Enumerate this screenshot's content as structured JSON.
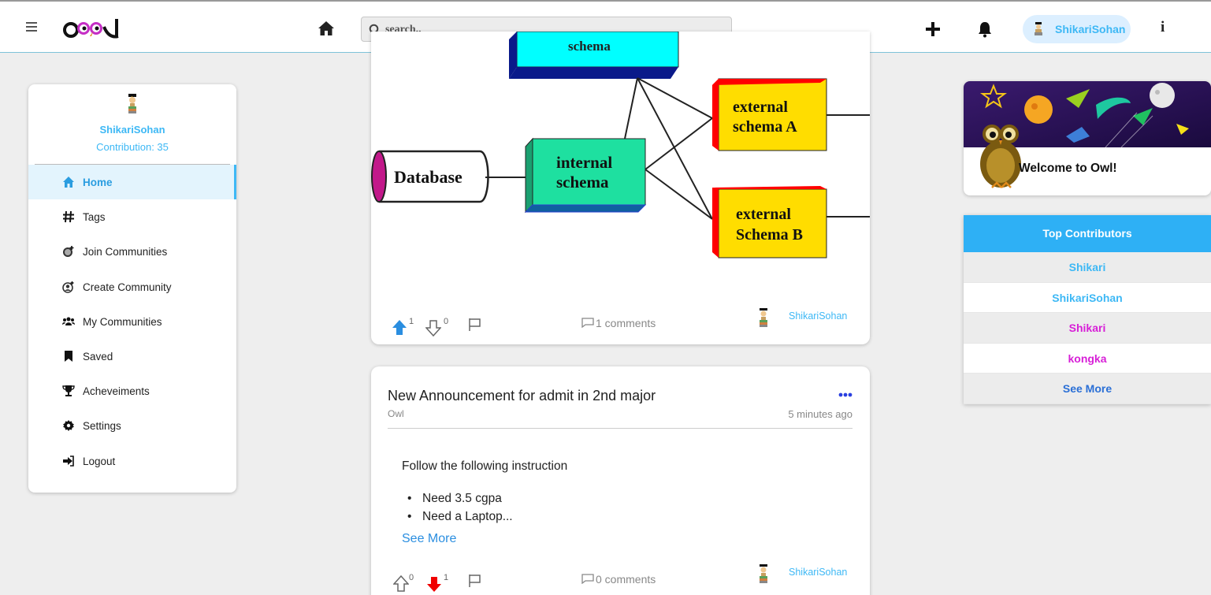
{
  "navbar": {
    "logo_text": "Owl",
    "search_placeholder": "search..",
    "username": "ShikariSohan",
    "info_glyph": "i",
    "icons": [
      "menu-icon",
      "home-icon",
      "search-icon",
      "plus-icon",
      "bell-icon",
      "info-icon"
    ]
  },
  "sidebar": {
    "username": "ShikariSohan",
    "contribution": "Contribution: 35",
    "items": [
      {
        "label": "Home",
        "icon": "home-icon",
        "active": true
      },
      {
        "label": "Tags",
        "icon": "hash-icon"
      },
      {
        "label": "Join Communities",
        "icon": "globe-plus-icon"
      },
      {
        "label": "Create Community",
        "icon": "user-plus-icon"
      },
      {
        "label": "My Communities",
        "icon": "users-icon"
      },
      {
        "label": "Saved",
        "icon": "bookmark-icon"
      },
      {
        "label": "Acheveiments",
        "icon": "trophy-icon"
      },
      {
        "label": "Settings",
        "icon": "cog-icon"
      },
      {
        "label": "Logout",
        "icon": "logout-icon"
      }
    ]
  },
  "post1": {
    "diagram": {
      "database": "Database",
      "internal_1": "internal",
      "internal_2": "schema",
      "extA_1": "external",
      "extA_2": "schema A",
      "extB_1": "external",
      "extB_2": "Schema B",
      "top_box_partial": "schema"
    },
    "upvotes": "1",
    "downvotes": "0",
    "upvoted": true,
    "comments": "1 comments",
    "author": "ShikariSohan"
  },
  "post2": {
    "title": "New Announcement for admit in 2nd major",
    "community": "Owl",
    "time": "5 minutes ago",
    "body": "Follow the following instruction",
    "bullets": [
      "Need 3.5 cgpa",
      "Need a Laptop..."
    ],
    "see_more": "See More",
    "upvotes": "0",
    "downvotes": "1",
    "downvoted": true,
    "comments": "0 comments",
    "author": "ShikariSohan"
  },
  "welcome": {
    "text": "Welcome to Owl!"
  },
  "top_contributors": {
    "header": "Top Contributors",
    "rows": [
      {
        "name": "Shikari",
        "color": "#3db8f5"
      },
      {
        "name": "ShikariSohan",
        "color": "#3db8f5"
      },
      {
        "name": "Shikari",
        "color": "#d71fd7"
      },
      {
        "name": "kongka",
        "color": "#d71fd7"
      }
    ],
    "see_more": "See More",
    "see_more_color": "#2a6fd6"
  },
  "colors": {
    "accent": "#3db8f5",
    "upvote": "#2a8ee0",
    "downvote": "#f00000"
  }
}
